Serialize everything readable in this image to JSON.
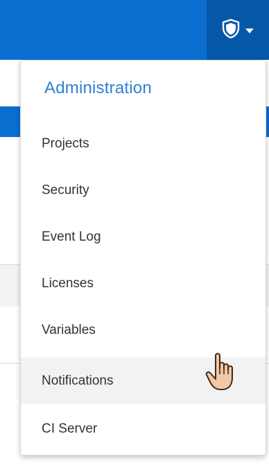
{
  "admin_menu": {
    "icon": "shield-icon",
    "header": "Administration",
    "items": [
      {
        "label": "Projects"
      },
      {
        "label": "Security"
      },
      {
        "label": "Event Log"
      },
      {
        "label": "Licenses"
      },
      {
        "label": "Variables"
      },
      {
        "label": "Notifications"
      },
      {
        "label": "CI Server"
      }
    ],
    "hovered_item": "Notifications"
  },
  "colors": {
    "topbar": "#0a6ed1",
    "admin_button": "#0558a8",
    "header_text": "#2f80d6",
    "item_text": "#333333",
    "hover_bg": "#f2f2f2"
  }
}
